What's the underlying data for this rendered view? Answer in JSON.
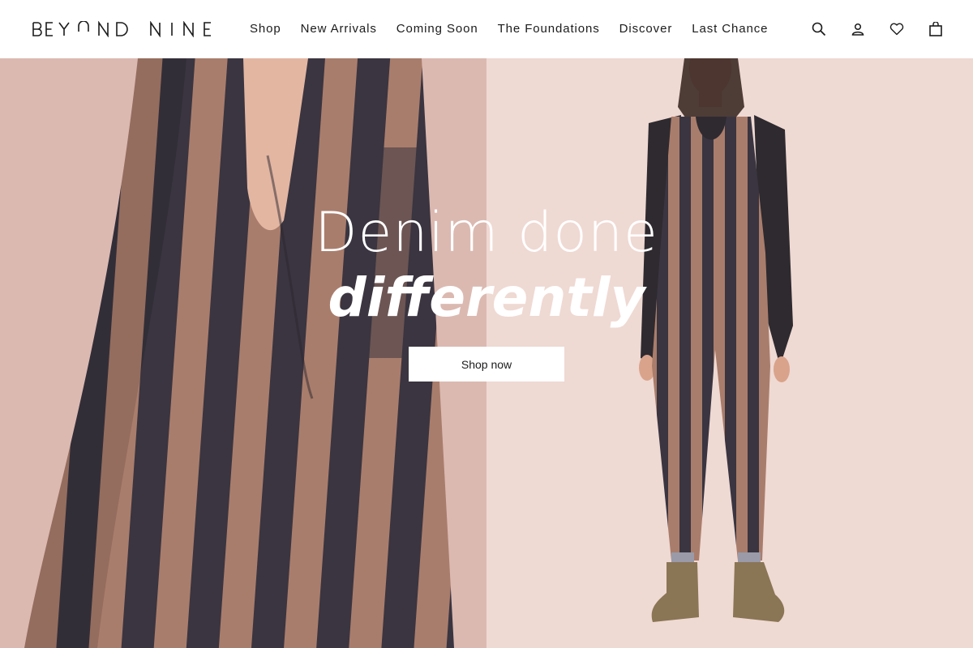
{
  "brand": {
    "logo_text": "BEYOND NINE"
  },
  "nav": {
    "items": [
      {
        "label": "Shop"
      },
      {
        "label": "New Arrivals"
      },
      {
        "label": "Coming Soon"
      },
      {
        "label": "The Foundations"
      },
      {
        "label": "Discover"
      },
      {
        "label": "Last Chance"
      }
    ]
  },
  "header_icons": [
    "search-icon",
    "account-icon",
    "wishlist-heart-icon",
    "shopping-bag-icon"
  ],
  "hero": {
    "headline_line1": "Denim done",
    "headline_line2": "differently",
    "cta_label": "Shop now"
  },
  "colors": {
    "header_bg": "#ffffff",
    "text": "#1b1b1b",
    "hero_left_bg": "#d8b5ae",
    "hero_right_bg": "#efd9d3",
    "stripe_dark": "#3a3540",
    "stripe_tan": "#a97d6c",
    "headline": "#ffffff",
    "cta_bg": "#ffffff"
  }
}
